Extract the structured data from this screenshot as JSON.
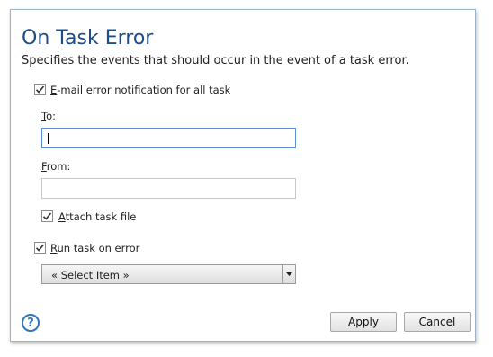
{
  "dialog": {
    "title": "On Task Error",
    "subtitle": "Specifies the events that should occur in the event of a task error."
  },
  "email_notification": {
    "checked": true,
    "label_underlined": "E",
    "label_rest": "-mail error notification for all task"
  },
  "to_field": {
    "label_underlined": "T",
    "label_rest": "o:",
    "value": ""
  },
  "from_field": {
    "label_underlined": "F",
    "label_rest": "rom:",
    "value": ""
  },
  "attach_task_file": {
    "checked": true,
    "label_underlined": "A",
    "label_rest": "ttach task file"
  },
  "run_task_on_error": {
    "checked": true,
    "label_underlined": "R",
    "label_rest": "un task on error"
  },
  "task_select": {
    "selected": "« Select Item »"
  },
  "buttons": {
    "apply": "Apply",
    "cancel": "Cancel",
    "help": "?"
  },
  "icons": {
    "checkmark": "checkmark-icon",
    "dropdown": "chevron-down-icon",
    "help": "help-icon"
  },
  "colors": {
    "title": "#1e4d8c",
    "focus_border": "#5b8fd6",
    "help_accent": "#2e75c2"
  }
}
